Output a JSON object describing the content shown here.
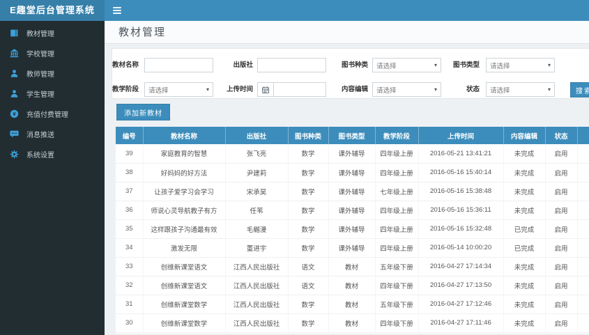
{
  "app": {
    "title": "E趣堂后台管理系统"
  },
  "sidebar": {
    "items": [
      {
        "label": "教材管理",
        "icon": "book-icon"
      },
      {
        "label": "学校管理",
        "icon": "school-icon"
      },
      {
        "label": "教师管理",
        "icon": "teacher-icon"
      },
      {
        "label": "学生管理",
        "icon": "student-icon"
      },
      {
        "label": "充值付费管理",
        "icon": "payment-icon"
      },
      {
        "label": "消息推送",
        "icon": "message-icon"
      },
      {
        "label": "系统设置",
        "icon": "settings-icon"
      }
    ]
  },
  "page": {
    "title": "教材管理"
  },
  "filters": {
    "fields": [
      {
        "label": "教材名称",
        "type": "text",
        "value": ""
      },
      {
        "label": "出版社",
        "type": "text",
        "value": ""
      },
      {
        "label": "图书种类",
        "type": "select",
        "value": "请选择"
      },
      {
        "label": "图书类型",
        "type": "select",
        "value": "请选择"
      },
      {
        "label": "教学阶段",
        "type": "select",
        "value": "请选择"
      },
      {
        "label": "上传时间",
        "type": "date",
        "value": ""
      },
      {
        "label": "内容编辑",
        "type": "select",
        "value": "请选择"
      },
      {
        "label": "状态",
        "type": "select",
        "value": "请选择"
      }
    ],
    "search_button": "搜索"
  },
  "toolbar": {
    "add_button": "添加新教材"
  },
  "table": {
    "headers": [
      "编号",
      "教材名称",
      "出版社",
      "图书种类",
      "图书类型",
      "教学阶段",
      "上传时间",
      "内容编辑",
      "状态"
    ],
    "rows": [
      [
        "39",
        "家庭教育的智慧",
        "张飞亮",
        "数学",
        "课外辅导",
        "四年级上册",
        "2016-05-21 13:41:21",
        "未完成",
        "启用"
      ],
      [
        "38",
        "好妈妈的好方法",
        "尹建莉",
        "数学",
        "课外辅导",
        "四年级上册",
        "2016-05-16 15:40:14",
        "未完成",
        "启用"
      ],
      [
        "37",
        "让孩子爱学习会学习",
        "宋承昊",
        "数学",
        "课外辅导",
        "七年级上册",
        "2016-05-16 15:38:48",
        "未完成",
        "启用"
      ],
      [
        "36",
        "师说心灵导航教子有方",
        "任苇",
        "数学",
        "课外辅导",
        "四年级上册",
        "2016-05-16 15:36:11",
        "未完成",
        "启用"
      ],
      [
        "35",
        "这样跟孩子沟通最有效",
        "毛樾漫",
        "数学",
        "课外辅导",
        "四年级上册",
        "2016-05-16 15:32:48",
        "已完成",
        "启用"
      ],
      [
        "34",
        "激发无限",
        "董进宇",
        "数学",
        "课外辅导",
        "四年级上册",
        "2016-05-14 10:00:20",
        "已完成",
        "启用"
      ],
      [
        "33",
        "创维新课堂语文",
        "江西人民出版社",
        "语文",
        "教材",
        "五年级下册",
        "2016-04-27 17:14:34",
        "未完成",
        "启用"
      ],
      [
        "32",
        "创维新课堂语文",
        "江西人民出版社",
        "语文",
        "教材",
        "四年级下册",
        "2016-04-27 17:13:50",
        "未完成",
        "启用"
      ],
      [
        "31",
        "创维新课堂数学",
        "江西人民出版社",
        "数学",
        "教材",
        "五年级下册",
        "2016-04-27 17:12:46",
        "未完成",
        "启用"
      ],
      [
        "30",
        "创维新课堂数学",
        "江西人民出版社",
        "数学",
        "教材",
        "四年级下册",
        "2016-04-27 17:11:46",
        "未完成",
        "启用"
      ]
    ]
  },
  "colors": {
    "navbar": "#3c8dbc",
    "logo_bg": "#367fa9",
    "sidebar_bg": "#222d32",
    "accent": "#3c8dbc",
    "icon_blue": "#3c9fd8"
  }
}
